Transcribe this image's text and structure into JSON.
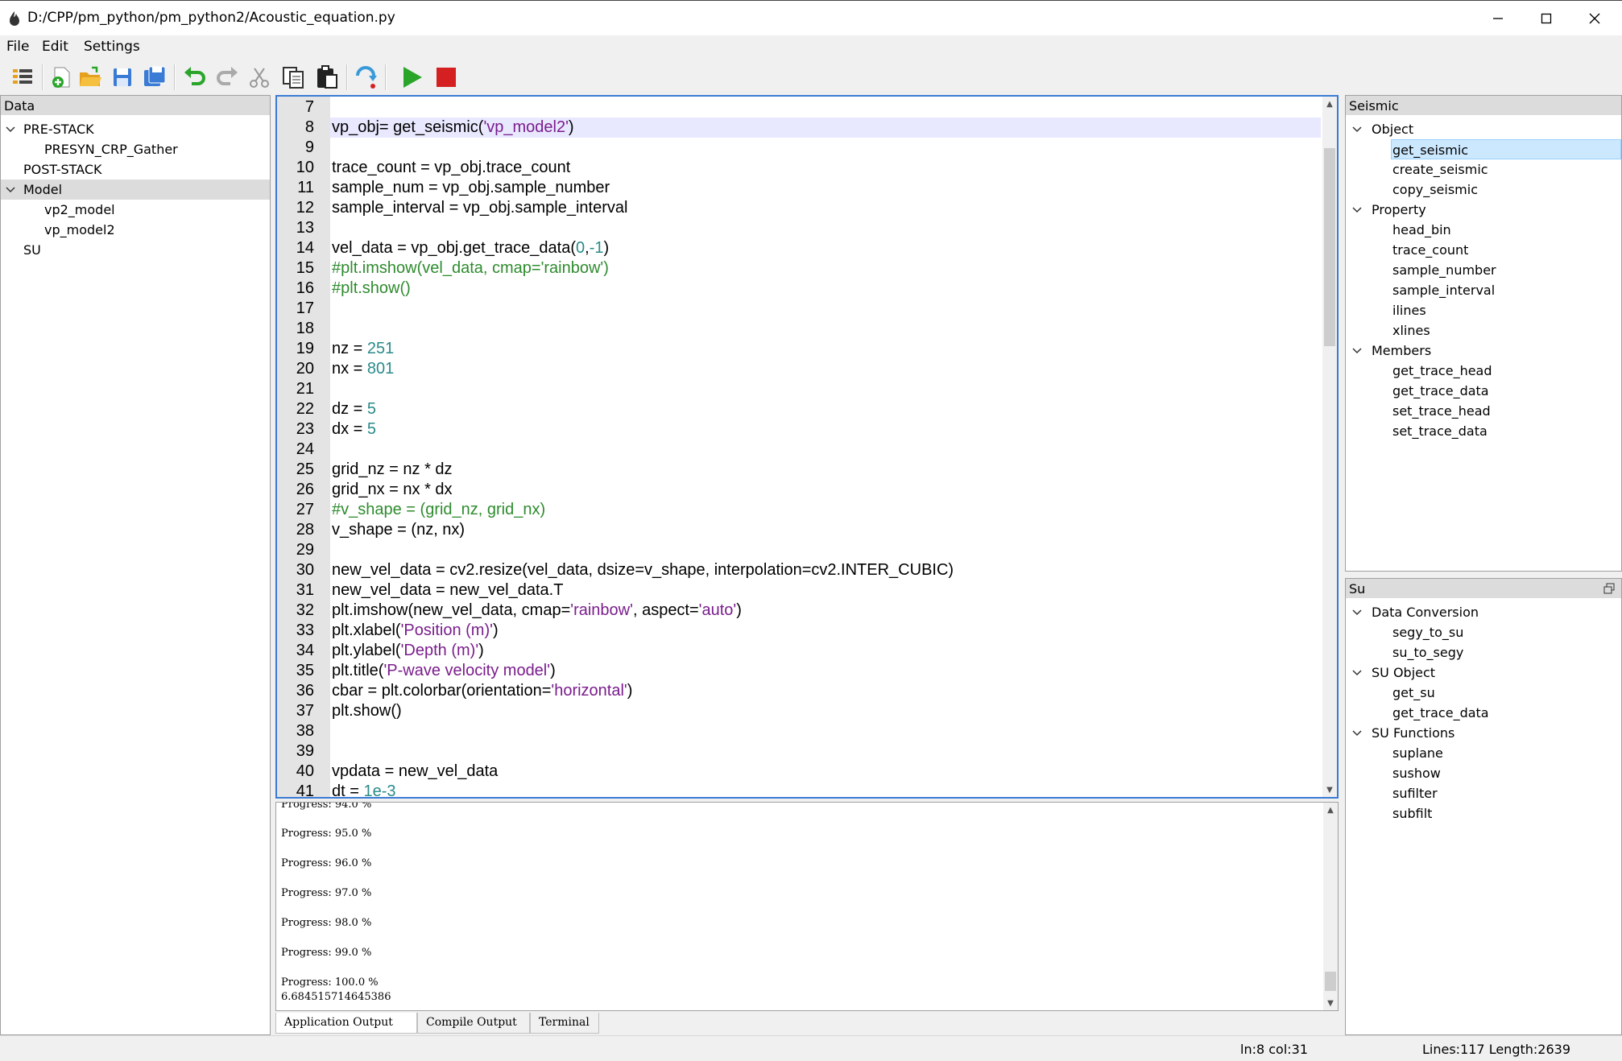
{
  "window": {
    "title": "D:/CPP/pm_python/pm_python2/Acoustic_equation.py"
  },
  "menu": {
    "file": "File",
    "edit": "Edit",
    "settings": "Settings"
  },
  "toolbar": {
    "icons": [
      "list-icon",
      "new-file-icon",
      "open-folder-icon",
      "save-icon",
      "save-all-icon",
      "undo-icon",
      "redo-icon",
      "cut-icon",
      "copy-icon",
      "paste-icon",
      "step-icon",
      "run-icon",
      "stop-icon"
    ],
    "colors": {
      "run": "#2aa52a",
      "stop": "#d42020",
      "save": "#3a7bd5"
    }
  },
  "data_panel": {
    "title": "Data",
    "items": [
      {
        "label": "PRE-STACK",
        "expanded": true
      },
      {
        "label": "PRESYN_CRP_Gather"
      },
      {
        "label": "POST-STACK"
      },
      {
        "label": "Model",
        "expanded": true,
        "selected": true
      },
      {
        "label": "vp2_model"
      },
      {
        "label": "vp_model2"
      },
      {
        "label": "SU"
      }
    ]
  },
  "editor": {
    "line_numbers": [
      "7",
      "8",
      "9",
      "10",
      "11",
      "12",
      "13",
      "14",
      "15",
      "16",
      "17",
      "18",
      "19",
      "20",
      "21",
      "22",
      "23",
      "24",
      "25",
      "26",
      "27",
      "28",
      "29",
      "30",
      "31",
      "32",
      "33",
      "34",
      "35",
      "36",
      "37",
      "38",
      "39",
      "40",
      "41"
    ],
    "lines": {
      "l8_a": "vp_obj= get_seismic(",
      "l8_s": "'vp_model2'",
      "l8_b": ")",
      "l10": "trace_count = vp_obj.trace_count",
      "l11": "sample_num = vp_obj.sample_number",
      "l12": "sample_interval = vp_obj.sample_interval",
      "l14_a": "vel_data = vp_obj.get_trace_data(",
      "l14_n1": "0",
      "l14_c": ",",
      "l14_n2": "-1",
      "l14_b": ")",
      "l15": "#plt.imshow(vel_data, cmap='rainbow')",
      "l16": "#plt.show()",
      "l19_a": "nz = ",
      "l19_n": "251",
      "l20_a": "nx = ",
      "l20_n": "801",
      "l22_a": "dz = ",
      "l22_n": "5",
      "l23_a": "dx = ",
      "l23_n": "5",
      "l25": "grid_nz = nz * dz",
      "l26": "grid_nx = nx * dx",
      "l27": "#v_shape = (grid_nz, grid_nx)",
      "l28": "v_shape = (nz, nx)",
      "l30": "new_vel_data = cv2.resize(vel_data, dsize=v_shape, interpolation=cv2.INTER_CUBIC)",
      "l31": "new_vel_data = new_vel_data.T",
      "l32_a": "plt.imshow(new_vel_data, cmap=",
      "l32_s1": "'rainbow'",
      "l32_b": ", aspect=",
      "l32_s2": "'auto'",
      "l32_c": ")",
      "l33_a": "plt.xlabel(",
      "l33_s": "'Position (m)'",
      "l33_b": ")",
      "l34_a": "plt.ylabel(",
      "l34_s": "'Depth (m)'",
      "l34_b": ")",
      "l35_a": "plt.title(",
      "l35_s": "'P-wave velocity model'",
      "l35_b": ")",
      "l36_a": "cbar = plt.colorbar(orientation=",
      "l36_s": "'horizontal'",
      "l36_b": ")",
      "l37": "plt.show()",
      "l40": "vpdata = new_vel_data",
      "l41_a": "dt = ",
      "l41_n": "1e-3"
    },
    "colors": {
      "string": "#7a1d8c",
      "number": "#2a8a8a",
      "comment": "#2e8b2e",
      "current_line": "#e8e8ff"
    }
  },
  "output": {
    "lines": [
      "Progress: 94.0 %",
      "Progress: 95.0 %",
      "Progress: 96.0 %",
      "Progress: 97.0 %",
      "Progress: 98.0 %",
      "Progress: 99.0 %",
      "Progress: 100.0 %",
      "6.684515714645386"
    ],
    "tabs": [
      "Application Output",
      "Compile Output",
      "Terminal"
    ]
  },
  "seismic_panel": {
    "title": "Seismic",
    "items": [
      {
        "label": "Object",
        "expanded": true
      },
      {
        "label": "get_seismic",
        "selected": true
      },
      {
        "label": "create_seismic"
      },
      {
        "label": "copy_seismic"
      },
      {
        "label": "Property",
        "expanded": true
      },
      {
        "label": "head_bin"
      },
      {
        "label": "trace_count"
      },
      {
        "label": "sample_number"
      },
      {
        "label": "sample_interval"
      },
      {
        "label": "ilines"
      },
      {
        "label": "xlines"
      },
      {
        "label": "Members",
        "expanded": true
      },
      {
        "label": "get_trace_head"
      },
      {
        "label": "get_trace_data"
      },
      {
        "label": "set_trace_head"
      },
      {
        "label": "set_trace_data"
      }
    ]
  },
  "su_panel": {
    "title": "Su",
    "items": [
      {
        "label": "Data Conversion",
        "expanded": true
      },
      {
        "label": "segy_to_su"
      },
      {
        "label": "su_to_segy"
      },
      {
        "label": "SU Object",
        "expanded": true
      },
      {
        "label": "get_su"
      },
      {
        "label": "get_trace_data"
      },
      {
        "label": "SU Functions",
        "expanded": true
      },
      {
        "label": "suplane"
      },
      {
        "label": "sushow"
      },
      {
        "label": "sufilter"
      },
      {
        "label": "subfilt"
      }
    ]
  },
  "status": {
    "cursor": "ln:8 col:31",
    "doc": "Lines:117 Length:2639"
  }
}
